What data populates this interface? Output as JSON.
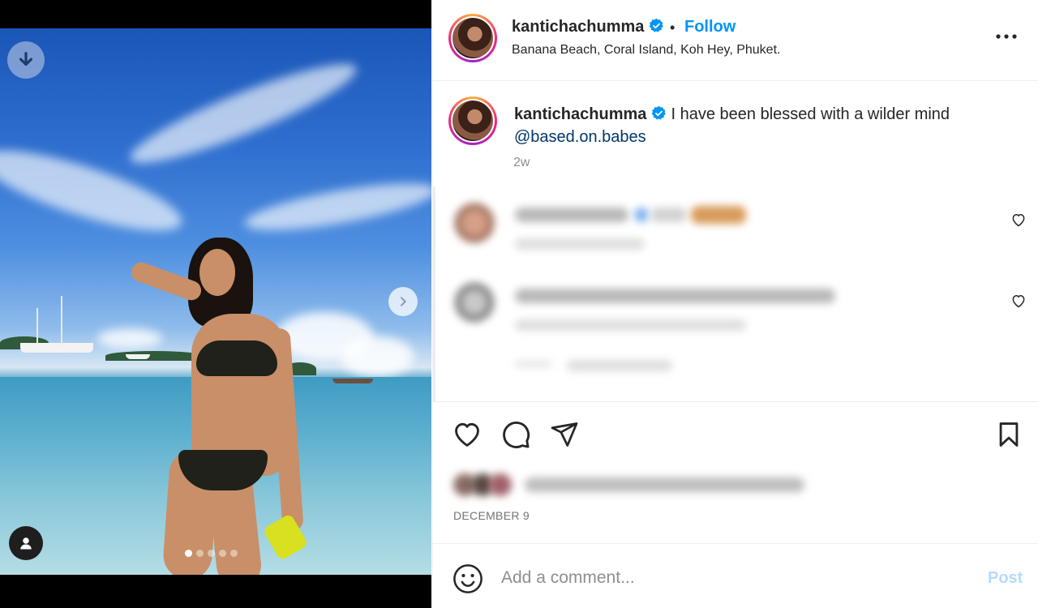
{
  "post": {
    "username": "kantichachumma",
    "verified": true,
    "follow_label": "Follow",
    "separator": "•",
    "location": "Banana Beach, Coral Island, Koh Hey, Phuket.",
    "caption_text": "I have been blessed with a wilder mind",
    "caption_mention": "@based.on.babes",
    "caption_time": "2w",
    "date": "DECEMBER 9",
    "carousel": {
      "total_slides": 5,
      "active_index": 0
    }
  },
  "comment_box": {
    "placeholder": "Add a comment...",
    "post_label": "Post"
  },
  "icons": {
    "download": "arrow-down-icon",
    "next": "chevron-right-icon",
    "tagged_user": "person-icon",
    "more": "more-horizontal-icon",
    "like": "heart-icon",
    "comment": "comment-bubble-icon",
    "share": "paper-plane-icon",
    "save": "bookmark-icon",
    "emoji": "smiley-icon"
  },
  "colors": {
    "follow": "#0095f6",
    "verified": "#0095f6",
    "mention": "#00376b",
    "post_disabled": "#b3dbff",
    "muted_text": "#8e8e8e"
  }
}
